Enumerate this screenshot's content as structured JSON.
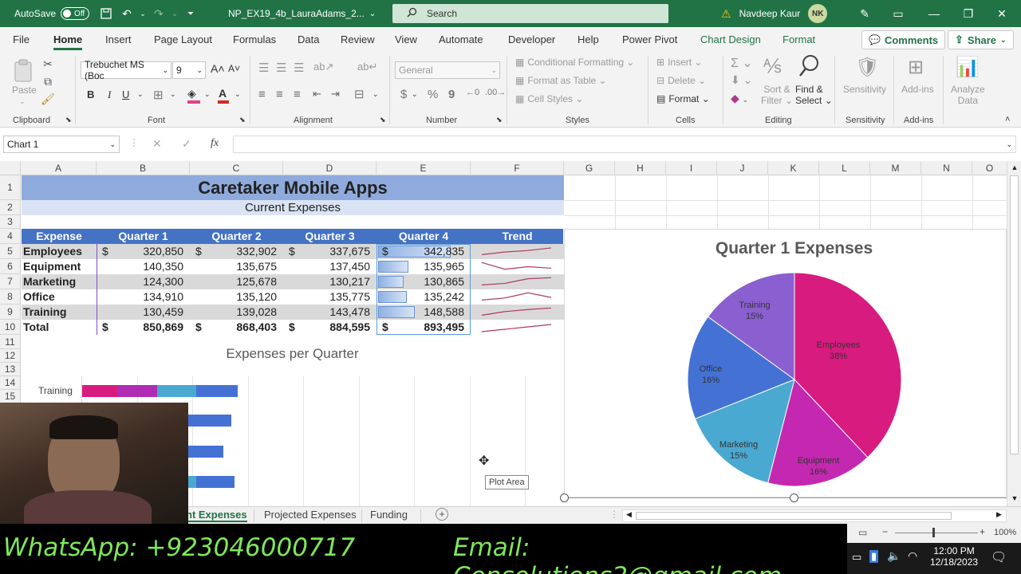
{
  "title_bar": {
    "autosave_label": "AutoSave",
    "autosave_state": "Off",
    "file_name": "NP_EX19_4b_LauraAdams_2...",
    "search_placeholder": "Search",
    "user_name": "Navdeep Kaur",
    "user_initials": "NK"
  },
  "ribbon_tabs": [
    "File",
    "Home",
    "Insert",
    "Page Layout",
    "Formulas",
    "Data",
    "Review",
    "View",
    "Automate",
    "Developer",
    "Help",
    "Power Pivot",
    "Chart Design",
    "Format"
  ],
  "share_buttons": {
    "comments": "Comments",
    "share": "Share"
  },
  "ribbon": {
    "clipboard": {
      "paste": "Paste",
      "label": "Clipboard"
    },
    "font": {
      "family": "Trebuchet MS (Boc",
      "size": "9",
      "bold": "B",
      "italic": "I",
      "underline": "U",
      "label": "Font"
    },
    "alignment": {
      "label": "Alignment"
    },
    "number": {
      "format": "General",
      "currency": "$",
      "percent": "%",
      "comma": "9",
      "label": "Number"
    },
    "styles": {
      "conditional": "Conditional Formatting",
      "table": "Format as Table",
      "cell_styles": "Cell Styles",
      "label": "Styles"
    },
    "cells": {
      "insert": "Insert",
      "delete": "Delete",
      "format": "Format",
      "label": "Cells"
    },
    "editing": {
      "sort_1": "Sort &",
      "sort_2": "Filter",
      "find_1": "Find &",
      "find_2": "Select",
      "label": "Editing"
    },
    "sensitivity": {
      "button": "Sensitivity",
      "label": "Sensitivity"
    },
    "addins": {
      "button": "Add-ins",
      "label": "Add-ins"
    },
    "analyze": {
      "line1": "Analyze",
      "line2": "Data"
    }
  },
  "formula_bar": {
    "name_box": "Chart 1",
    "fx": "fx",
    "formula": ""
  },
  "columns": [
    "A",
    "B",
    "C",
    "D",
    "E",
    "F",
    "G",
    "H",
    "I",
    "J",
    "K",
    "L",
    "M",
    "N",
    "O"
  ],
  "rows": [
    "1",
    "2",
    "3",
    "4",
    "5",
    "6",
    "7",
    "8",
    "9",
    "10",
    "11",
    "12",
    "13",
    "14",
    "15"
  ],
  "sheet": {
    "title": "Caretaker Mobile Apps",
    "subtitle": "Current Expenses",
    "headers": [
      "Expense",
      "Quarter 1",
      "Quarter 2",
      "Quarter 3",
      "Quarter 4",
      "Trend"
    ],
    "currency_symbol": "$",
    "rows": [
      {
        "label": "Employees",
        "q1": "320,850",
        "q2": "332,902",
        "q3": "337,675",
        "q4": "342,835",
        "q4_bar": 0.8,
        "trend": [
          0.2,
          0.45,
          0.6,
          0.85
        ]
      },
      {
        "label": "Equipment",
        "q1": "140,350",
        "q2": "135,675",
        "q3": "137,450",
        "q4": "135,965",
        "q4_bar": 0.33,
        "trend": [
          0.9,
          0.25,
          0.5,
          0.35
        ]
      },
      {
        "label": "Marketing",
        "q1": "124,300",
        "q2": "125,678",
        "q3": "130,217",
        "q4": "130,865",
        "q4_bar": 0.28,
        "trend": [
          0.2,
          0.35,
          0.8,
          0.9
        ]
      },
      {
        "label": "Office",
        "q1": "134,910",
        "q2": "135,120",
        "q3": "135,775",
        "q4": "135,242",
        "q4_bar": 0.32,
        "trend": [
          0.2,
          0.4,
          0.9,
          0.45
        ]
      },
      {
        "label": "Training",
        "q1": "130,459",
        "q2": "139,028",
        "q3": "143,478",
        "q4": "148,588",
        "q4_bar": 0.4,
        "trend": [
          0.2,
          0.55,
          0.75,
          0.9
        ]
      }
    ],
    "total": {
      "label": "Total",
      "q1": "850,869",
      "q2": "868,403",
      "q3": "884,595",
      "q4": "893,495"
    }
  },
  "bar_chart": {
    "title": "Expenses per Quarter",
    "category_label": "Training"
  },
  "tooltip": "Plot Area",
  "chart_data": {
    "type": "pie",
    "title": "Quarter 1 Expenses",
    "categories": [
      "Employees",
      "Equipment",
      "Marketing",
      "Office",
      "Training"
    ],
    "values": [
      38,
      16,
      15,
      16,
      15
    ],
    "labels": [
      "38%",
      "16%",
      "15%",
      "16%",
      "15%"
    ],
    "colors": [
      "#d81b7f",
      "#c428b0",
      "#4aa9d0",
      "#4472d4",
      "#8a5fcf"
    ]
  },
  "sheet_tabs": {
    "current": "nt Expenses",
    "projected": "Projected Expenses",
    "funding": "Funding"
  },
  "status": {
    "zoom": "100%"
  },
  "promo": {
    "whatsapp": "WhatsApp: +923046000717",
    "email": "Email: Censolutions2@gmail.com"
  },
  "taskbar": {
    "time": "12:00 PM",
    "date": "12/18/2023"
  }
}
